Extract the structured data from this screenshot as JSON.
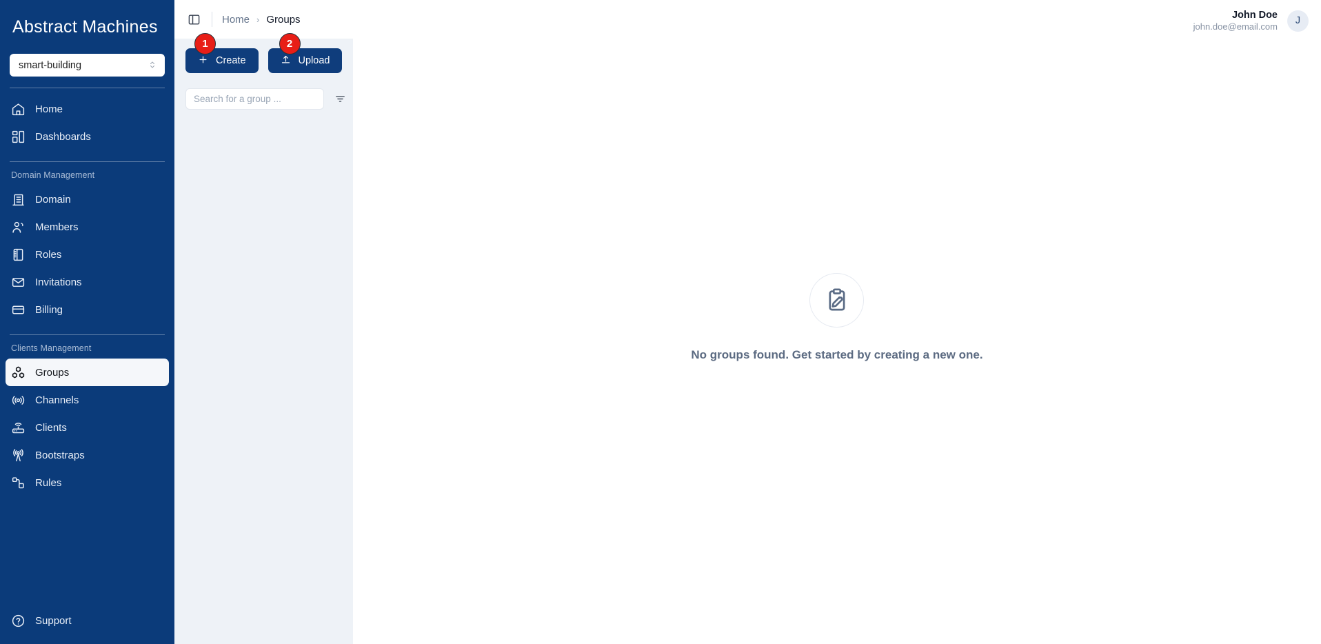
{
  "colors": {
    "sidebar_bg": "#0b3b7a",
    "panel_bg": "#eef2f7",
    "accent": "#0f3d7c",
    "badge_red": "#e81e17",
    "active_item_bg": "#f5f7fa"
  },
  "sidebar": {
    "logo": "Abstract Machines",
    "domain_selector": {
      "value": "smart-building"
    },
    "primary_items": [
      {
        "label": "Home",
        "icon": "home-icon"
      },
      {
        "label": "Dashboards",
        "icon": "dashboards-grid-icon"
      }
    ],
    "sections": [
      {
        "title": "Domain Management",
        "items": [
          {
            "label": "Domain",
            "icon": "building-icon"
          },
          {
            "label": "Members",
            "icon": "users-icon"
          },
          {
            "label": "Roles",
            "icon": "book-icon"
          },
          {
            "label": "Invitations",
            "icon": "envelope-icon"
          },
          {
            "label": "Billing",
            "icon": "credit-card-icon"
          }
        ]
      },
      {
        "title": "Clients Management",
        "items": [
          {
            "label": "Groups",
            "icon": "cubes-icon",
            "active": true
          },
          {
            "label": "Channels",
            "icon": "broadcast-icon"
          },
          {
            "label": "Clients",
            "icon": "router-icon"
          },
          {
            "label": "Bootstraps",
            "icon": "radio-tower-icon"
          },
          {
            "label": "Rules",
            "icon": "nodes-icon"
          }
        ]
      }
    ],
    "support": {
      "label": "Support",
      "icon": "help-circle-icon"
    }
  },
  "topbar": {
    "toggle_icon": "sidebar-toggle-icon",
    "breadcrumb": {
      "home": "Home",
      "separator": "›",
      "current": "Groups"
    },
    "user": {
      "name": "John Doe",
      "email": "john.doe@email.com",
      "avatar_initial": "J"
    }
  },
  "list_panel": {
    "create_button": {
      "label": "Create",
      "icon": "plus-icon",
      "badge": "1"
    },
    "upload_button": {
      "label": "Upload",
      "icon": "upload-icon",
      "badge": "2"
    },
    "search": {
      "placeholder": "Search for a group ...",
      "value": ""
    },
    "filter_icon": "filter-icon"
  },
  "main": {
    "empty_state": {
      "icon": "clipboard-pencil-icon",
      "message": "No groups found. Get started by creating a new one."
    }
  }
}
